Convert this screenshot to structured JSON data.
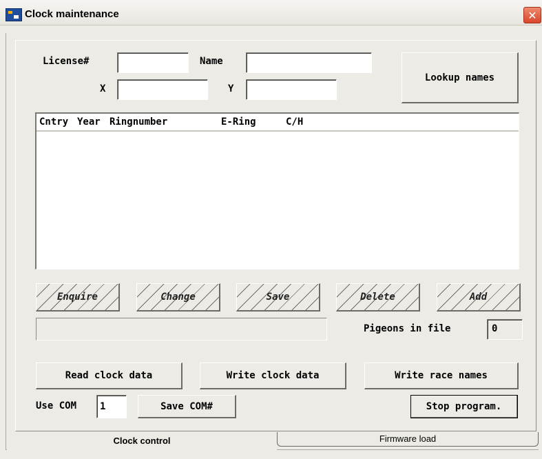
{
  "window": {
    "title": "Clock maintenance",
    "close_glyph": "✕"
  },
  "header": {
    "license_label": "License#",
    "license_value": "",
    "name_label": "Name",
    "name_value": "",
    "x_label": "X",
    "x_value": "",
    "y_label": "Y",
    "y_value": "",
    "lookup_label": "Lookup names"
  },
  "list": {
    "columns": [
      "Cntry",
      "Year",
      "Ringnumber",
      "E-Ring",
      "C/H"
    ],
    "rows": []
  },
  "actions": [
    "Enquire",
    "Change",
    "Save",
    "Delete",
    "Add"
  ],
  "pigeons": {
    "label": "Pigeons in file",
    "value": "0"
  },
  "bottom_buttons": {
    "read": "Read clock data",
    "write": "Write clock data",
    "race": "Write race names"
  },
  "com": {
    "label": "Use COM",
    "value": "1",
    "save_label": "Save COM#"
  },
  "stop_label": "Stop program.",
  "tabs": {
    "active": "Clock control",
    "inactive": "Firmware load"
  }
}
